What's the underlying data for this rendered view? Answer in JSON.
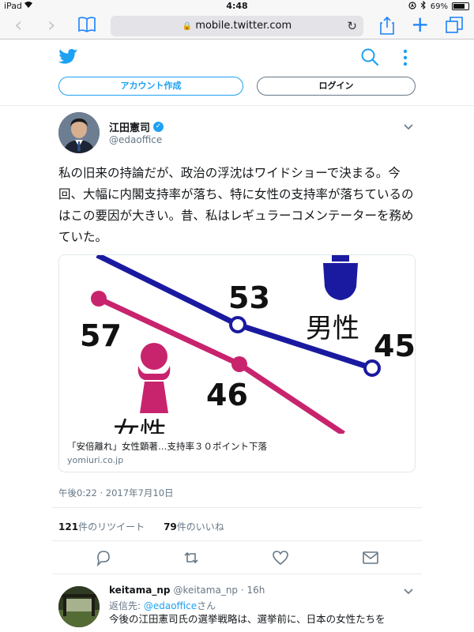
{
  "status_bar": {
    "device": "iPad",
    "time": "4:48",
    "battery": "69%",
    "battery_level": 0.69
  },
  "browser": {
    "url": "mobile.twitter.com"
  },
  "header": {
    "signup_label": "アカウント作成",
    "login_label": "ログイン"
  },
  "tweet": {
    "author_name": "江田憲司",
    "author_handle": "@edaoffice",
    "text": "私の旧来の持論だが、政治の浮沈はワイドショーで決まる。今回、大幅に内閣支持率が落ち、特に女性の支持率が落ちているのはこの要因が大きい。昔、私はレギュラーコメンテーターを務めていた。",
    "card": {
      "title": "「安倍離れ」女性顕著…支持率３０ポイント下落",
      "domain": "yomiuri.co.jp",
      "image": {
        "label_53": "53",
        "label_57": "57",
        "label_46": "46",
        "label_45": "45",
        "male_label": "男性",
        "female_label": "女性",
        "male_color": "#1a1aa0",
        "female_color": "#c8246e"
      }
    },
    "timestamp": "午後0:22 · 2017年7月10日",
    "retweets": {
      "count": "121",
      "label": "件のリツイート"
    },
    "likes": {
      "count": "79",
      "label": "件のいいね"
    }
  },
  "reply": {
    "author_name": "keitama_np",
    "author_handle": "@keitama_np · 16h",
    "reply_prefix": "返信先: ",
    "reply_mention": "@edaoffice",
    "reply_suffix": "さん",
    "text": "今後の江田憲司氏の選挙戦略は、選挙前に、日本の女性たちを"
  },
  "colors": {
    "twitter_blue": "#1da1f2",
    "ios_blue": "#1a82fb",
    "muted": "#657786"
  }
}
